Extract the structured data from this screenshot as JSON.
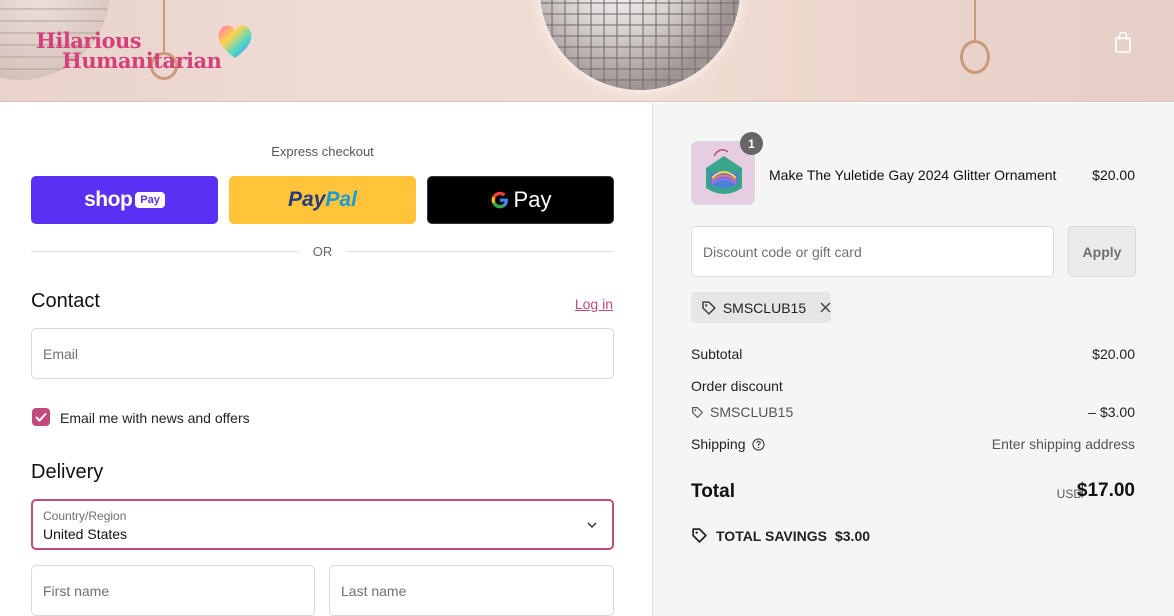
{
  "header": {
    "logo_line1": "Hilarious",
    "logo_line2": "Humanitarian",
    "logo_icon": "heart-icon",
    "cart_icon": "shopping-bag-icon"
  },
  "express": {
    "label": "Express checkout",
    "shop_pay": {
      "brand": "shop",
      "badge": "Pay",
      "color": "#5a31f4"
    },
    "paypal": {
      "part1": "Pay",
      "part2": "Pal",
      "color": "#ffc439"
    },
    "gpay": {
      "text": "Pay",
      "color": "#000000"
    },
    "divider_text": "OR"
  },
  "contact": {
    "title": "Contact",
    "login_link": "Log in",
    "email_placeholder": "Email",
    "newsletter_label": "Email me with news and offers",
    "newsletter_checked": true
  },
  "delivery": {
    "title": "Delivery",
    "country_label": "Country/Region",
    "country_value": "United States",
    "first_name_placeholder": "First name",
    "last_name_placeholder": "Last name"
  },
  "summary": {
    "item": {
      "quantity": "1",
      "name": "Make The Yuletide Gay 2024 Glitter Ornament",
      "price": "$20.00"
    },
    "discount_placeholder": "Discount code or gift card",
    "apply_label": "Apply",
    "applied_code": "SMSCLUB15",
    "subtotal_label": "Subtotal",
    "subtotal_value": "$20.00",
    "order_discount_label": "Order discount",
    "order_discount_code": "SMSCLUB15",
    "order_discount_value": "– $3.00",
    "shipping_label": "Shipping",
    "shipping_value": "Enter shipping address",
    "total_label": "Total",
    "total_currency": "USD",
    "total_value": "$17.00",
    "savings_label": "TOTAL SAVINGS",
    "savings_value": "$3.00"
  },
  "colors": {
    "accent": "#c24a7e",
    "brand_pink": "#d6407a"
  }
}
